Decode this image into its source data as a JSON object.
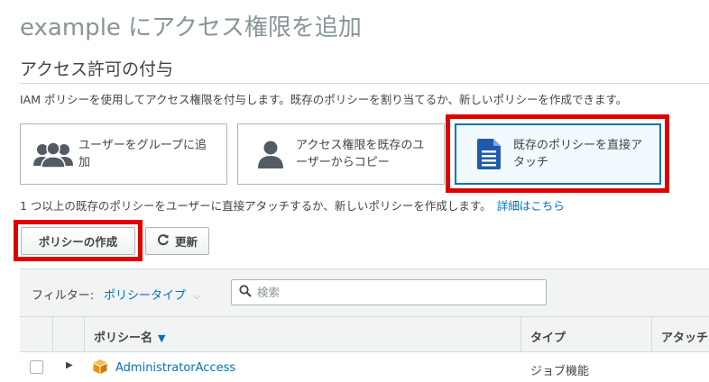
{
  "header": {
    "page_title": "example にアクセス権限を追加",
    "section_title": "アクセス許可の付与",
    "description": "IAM ポリシーを使用してアクセス権限を付与します。既存のポリシーを割り当てるか、新しいポリシーを作成できます。"
  },
  "options": [
    {
      "label": "ユーザーをグループに追加",
      "icon": "group-icon",
      "selected": false
    },
    {
      "label": "アクセス権限を既存のユーザーからコピー",
      "icon": "user-icon",
      "selected": false
    },
    {
      "label": "既存のポリシーを直接アタッチ",
      "icon": "document-icon",
      "selected": true
    }
  ],
  "info": {
    "text": "1 つ以上の既存のポリシーをユーザーに直接アタッチするか、新しいポリシーを作成します。",
    "link": "詳細はこちら"
  },
  "toolbar": {
    "create_label": "ポリシーの作成",
    "refresh_label": "更新",
    "refresh_icon": "refresh-icon"
  },
  "filter": {
    "label": "フィルター:",
    "dropdown_value": "ポリシータイプ",
    "search_placeholder": "検索"
  },
  "table": {
    "columns": [
      "ポリシー名",
      "タイプ",
      "アタッチ"
    ],
    "sort_column": "ポリシー名",
    "rows": [
      {
        "name": "AdministratorAccess",
        "type": "ジョブ機能",
        "icon": "policy-cube-icon"
      }
    ]
  },
  "colors": {
    "accent": "#0073bb",
    "highlight": "#e00000",
    "selected_bg": "#f1faff",
    "policy_icon": "#f29100"
  }
}
